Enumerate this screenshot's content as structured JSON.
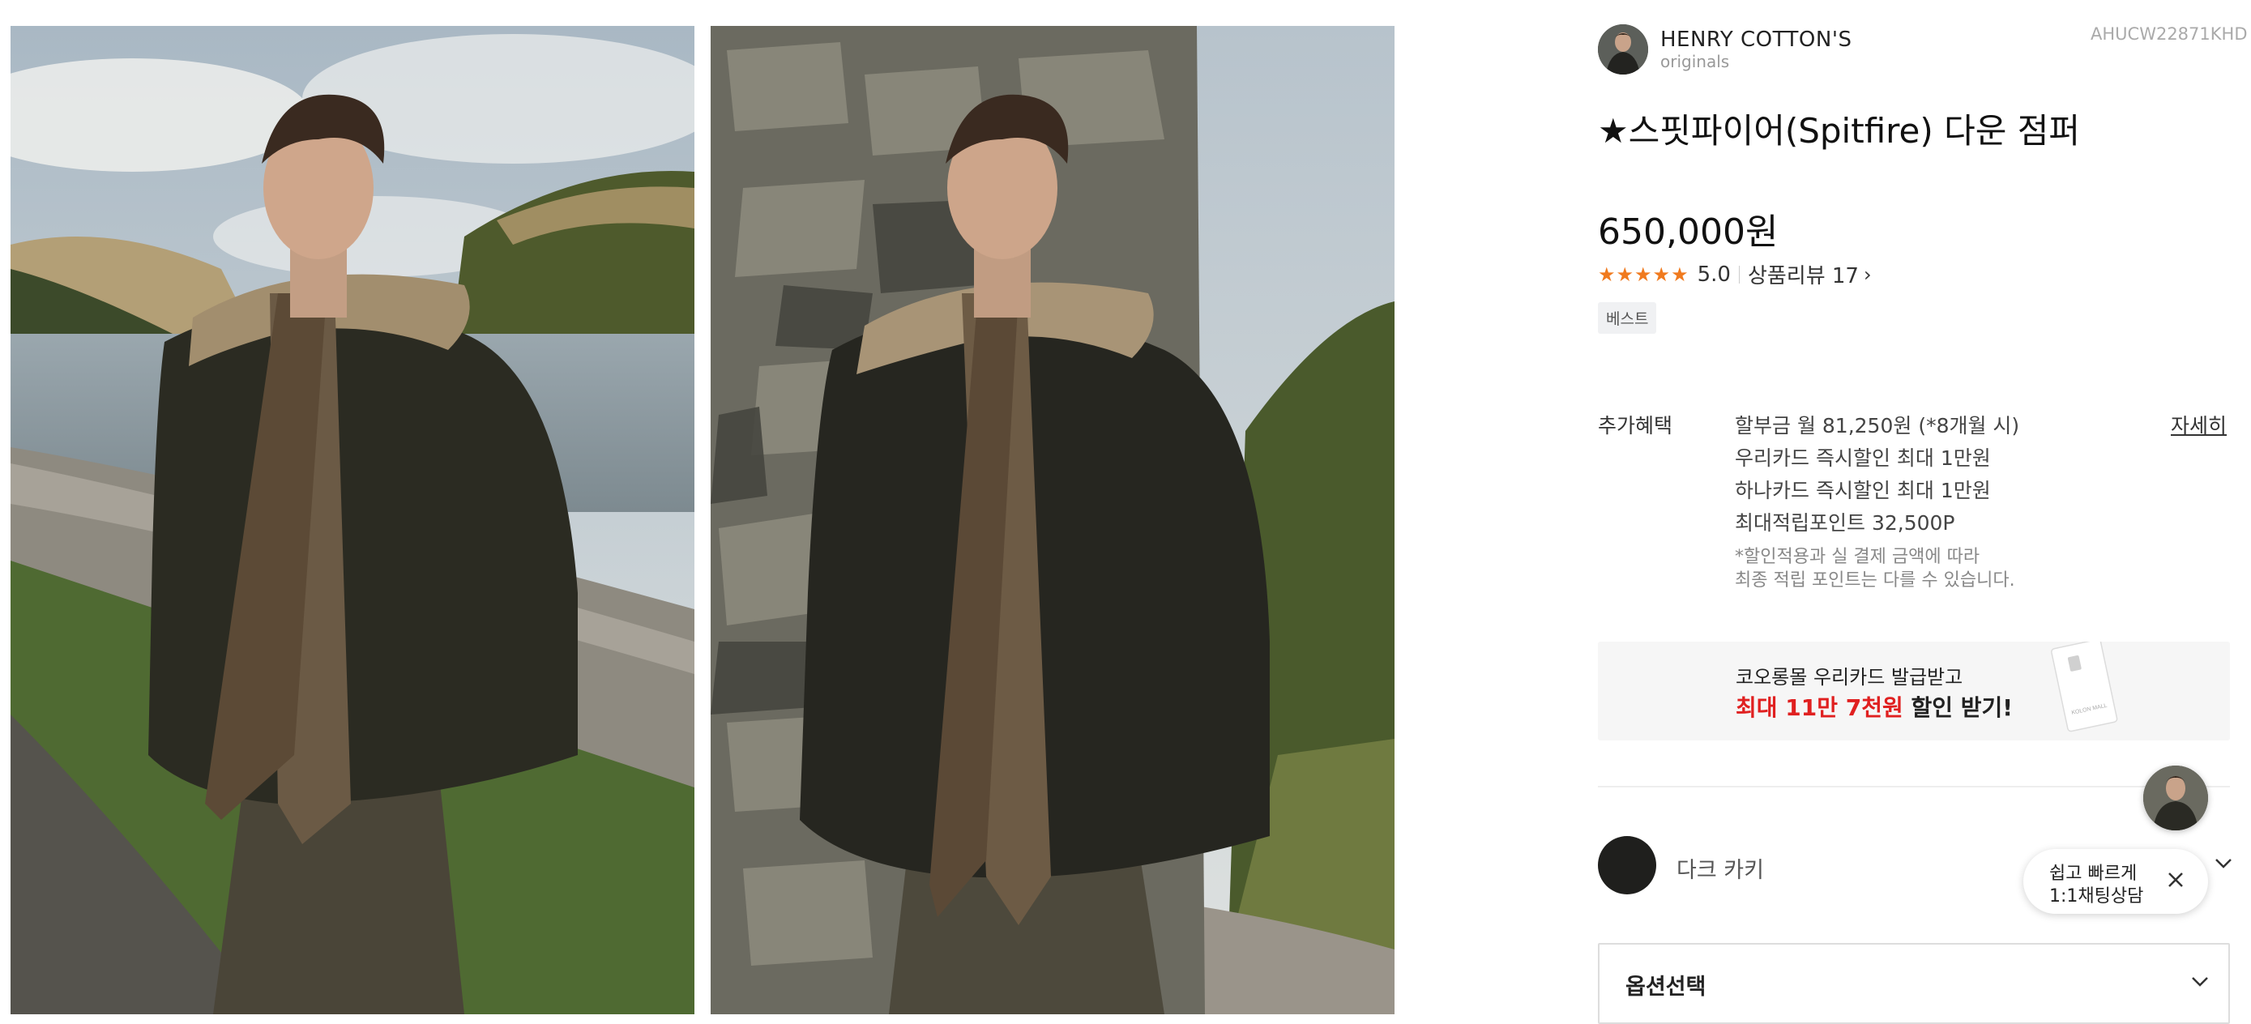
{
  "brand": {
    "name": "HENRY COTTON'S",
    "sub": "originals"
  },
  "product": {
    "code": "AHUCW22871KHD",
    "title": "★스핏파이어(Spitfire) 다운 점퍼",
    "price": "650,000원",
    "rating_stars": "★★★★★",
    "rating_value": "5.0",
    "review_label": "상품리뷰 17",
    "badge": "베스트"
  },
  "benefits": {
    "label": "추가혜택",
    "lines": [
      "할부금 월 81,250원 (*8개월 시)",
      "우리카드 즉시할인 최대 1만원",
      "하나카드 즉시할인 최대 1만원",
      "최대적립포인트 32,500P"
    ],
    "note_line1": "*할인적용과 실 결제 금액에 따라",
    "note_line2": "최종 적립 포인트는 다를 수 있습니다.",
    "detail_link": "자세히"
  },
  "banner": {
    "line1": "코오롱몰 우리카드 발급받고",
    "line2_highlight": "최대 11만 7천원",
    "line2_rest": " 할인 받기!",
    "card_text": "KOLON MALL"
  },
  "color_option": {
    "name": "다크 카키",
    "swatch_color": "#1f1f1d"
  },
  "chat": {
    "line1": "쉽고 빠르게",
    "line2": "1:1채팅상담"
  },
  "option_select": {
    "label": "옵션선택"
  },
  "colors": {
    "star": "#f07a1e",
    "highlight_red": "#e02020"
  }
}
